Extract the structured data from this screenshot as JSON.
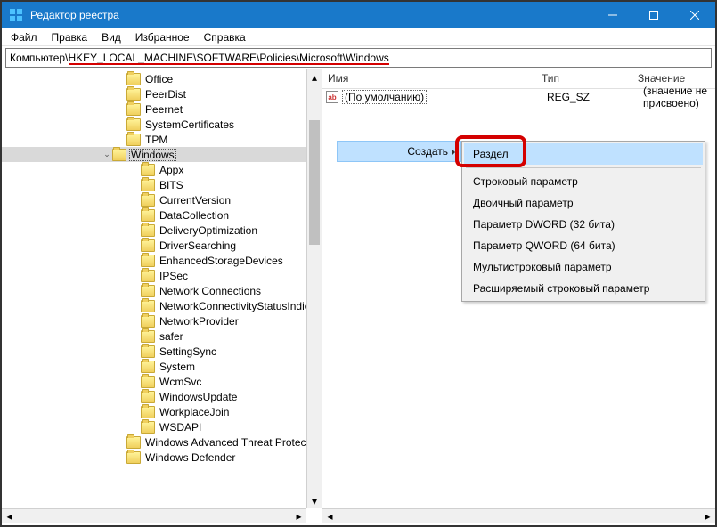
{
  "title": "Редактор реестра",
  "menu": [
    "Файл",
    "Правка",
    "Вид",
    "Избранное",
    "Справка"
  ],
  "address": "Компьютер\\HKEY_LOCAL_MACHINE\\SOFTWARE\\Policies\\Microsoft\\Windows",
  "tree": [
    {
      "indent": 128,
      "chevron": "",
      "label": "Office"
    },
    {
      "indent": 128,
      "chevron": "",
      "label": "PeerDist"
    },
    {
      "indent": 128,
      "chevron": "",
      "label": "Peernet"
    },
    {
      "indent": 128,
      "chevron": "",
      "label": "SystemCertificates"
    },
    {
      "indent": 128,
      "chevron": "",
      "label": "TPM"
    },
    {
      "indent": 112,
      "chevron": "v",
      "label": "Windows",
      "selected": true
    },
    {
      "indent": 144,
      "chevron": "",
      "label": "Appx"
    },
    {
      "indent": 144,
      "chevron": "",
      "label": "BITS"
    },
    {
      "indent": 144,
      "chevron": "",
      "label": "CurrentVersion"
    },
    {
      "indent": 144,
      "chevron": "",
      "label": "DataCollection"
    },
    {
      "indent": 144,
      "chevron": "",
      "label": "DeliveryOptimization"
    },
    {
      "indent": 144,
      "chevron": "",
      "label": "DriverSearching"
    },
    {
      "indent": 144,
      "chevron": "",
      "label": "EnhancedStorageDevices"
    },
    {
      "indent": 144,
      "chevron": "",
      "label": "IPSec"
    },
    {
      "indent": 144,
      "chevron": "",
      "label": "Network Connections"
    },
    {
      "indent": 144,
      "chevron": "",
      "label": "NetworkConnectivityStatusIndic"
    },
    {
      "indent": 144,
      "chevron": "",
      "label": "NetworkProvider"
    },
    {
      "indent": 144,
      "chevron": "",
      "label": "safer"
    },
    {
      "indent": 144,
      "chevron": "",
      "label": "SettingSync"
    },
    {
      "indent": 144,
      "chevron": "",
      "label": "System"
    },
    {
      "indent": 144,
      "chevron": "",
      "label": "WcmSvc"
    },
    {
      "indent": 144,
      "chevron": "",
      "label": "WindowsUpdate"
    },
    {
      "indent": 144,
      "chevron": "",
      "label": "WorkplaceJoin"
    },
    {
      "indent": 144,
      "chevron": "",
      "label": "WSDAPI"
    },
    {
      "indent": 128,
      "chevron": "",
      "label": "Windows Advanced Threat Protectio"
    },
    {
      "indent": 128,
      "chevron": "",
      "label": "Windows Defender"
    }
  ],
  "list_columns": {
    "name": "Имя",
    "type": "Тип",
    "value": "Значение"
  },
  "list_rows": [
    {
      "icon": "ab",
      "name": "(По умолчанию)",
      "type": "REG_SZ",
      "value": "(значение не присвоено)"
    }
  ],
  "context": {
    "create": "Создать",
    "items": [
      "Раздел",
      "-",
      "Строковый параметр",
      "Двоичный параметр",
      "Параметр DWORD (32 бита)",
      "Параметр QWORD (64 бита)",
      "Мультистроковый параметр",
      "Расширяемый строковый параметр"
    ]
  }
}
